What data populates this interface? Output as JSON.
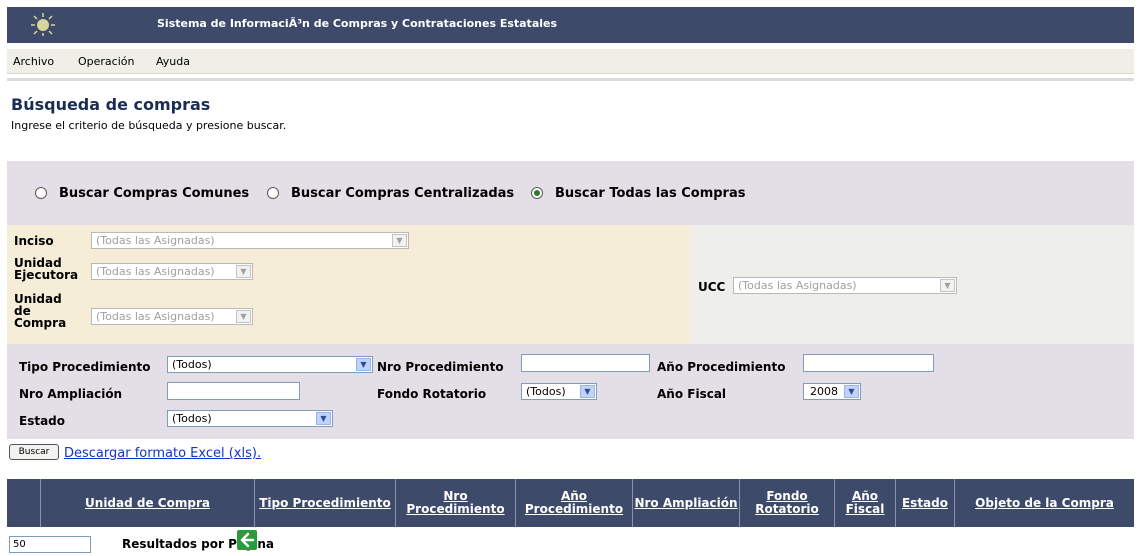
{
  "header": {
    "title": "Sistema de InformaciÃ³n de Compras y Contrataciones Estatales",
    "logo_icon": "sun-emblem-icon",
    "bg_color": "#3d4a6a"
  },
  "menu": {
    "items": [
      {
        "label": "Archivo"
      },
      {
        "label": "Operación"
      },
      {
        "label": "Ayuda"
      }
    ]
  },
  "page": {
    "title": "Búsqueda de compras",
    "instructions": "Ingrese el criterio de búsqueda y presione buscar."
  },
  "search_type": {
    "options": [
      {
        "label": "Buscar Compras Comunes",
        "selected": false
      },
      {
        "label": "Buscar Compras Centralizadas",
        "selected": false
      },
      {
        "label": "Buscar Todas las Compras",
        "selected": true
      }
    ]
  },
  "filters": {
    "inciso": {
      "label": "Inciso",
      "value": "(Todas las Asignadas)"
    },
    "unidad_ejecutora": {
      "label": "Unidad Ejecutora",
      "value": "(Todas las Asignadas)"
    },
    "unidad_compra": {
      "label": "Unidad de Compra",
      "value": "(Todas las Asignadas)"
    },
    "ucc": {
      "label": "UCC",
      "value": "(Todas las Asignadas)"
    },
    "tipo_procedimiento": {
      "label": "Tipo Procedimiento",
      "value": "(Todos)"
    },
    "nro_procedimiento": {
      "label": "Nro Procedimiento",
      "value": ""
    },
    "anio_procedimiento": {
      "label": "Año Procedimiento",
      "value": ""
    },
    "nro_ampliacion": {
      "label": "Nro Ampliación",
      "value": ""
    },
    "fondo_rotatorio": {
      "label": "Fondo Rotatorio",
      "value": "(Todos)"
    },
    "anio_fiscal": {
      "label": "Año Fiscal",
      "value": "2008"
    },
    "estado": {
      "label": "Estado",
      "value": "(Todos)"
    }
  },
  "actions": {
    "buscar_label": "Buscar",
    "excel_link": "Descargar formato Excel (xls)."
  },
  "results": {
    "columns": [
      {
        "label": "Unidad de Compra"
      },
      {
        "label": "Tipo Procedimiento"
      },
      {
        "label": "Nro Procedimiento"
      },
      {
        "label": "Año Procedimiento"
      },
      {
        "label": "Nro Ampliación"
      },
      {
        "label": "Fondo Rotatorio"
      },
      {
        "label": "Año Fiscal"
      },
      {
        "label": "Estado"
      },
      {
        "label": "Objeto de la Compra"
      }
    ]
  },
  "pagination": {
    "per_page_value": "50",
    "per_page_label": "Resultados por Página",
    "go_icon": "arrow-left-icon"
  }
}
